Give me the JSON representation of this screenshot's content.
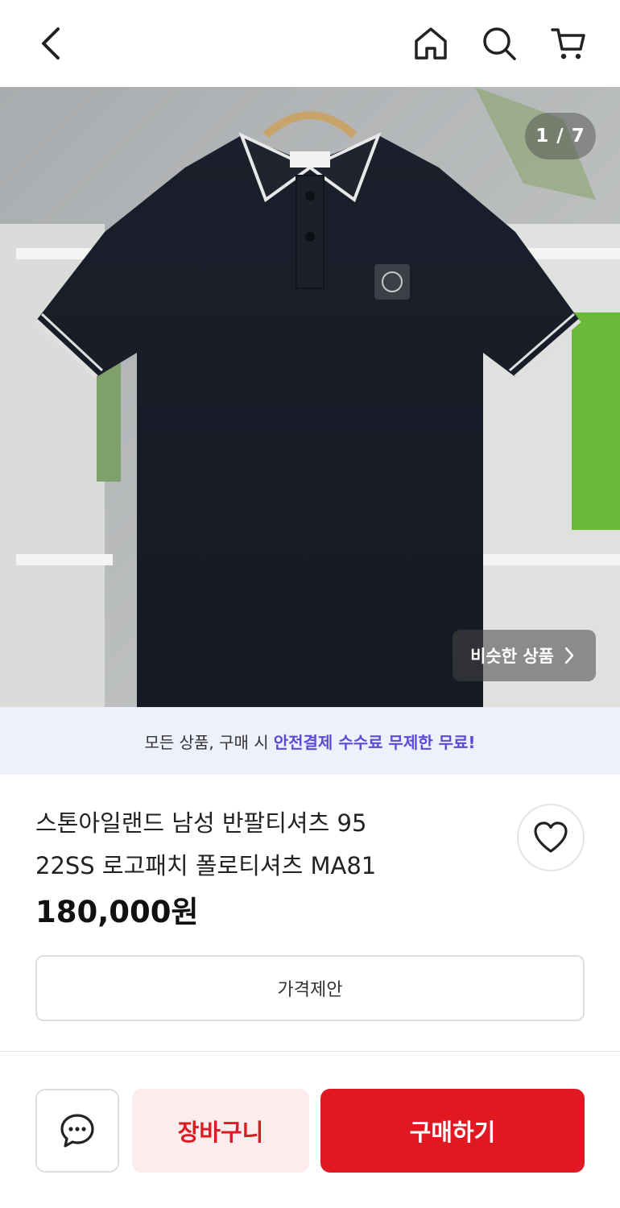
{
  "header": {
    "back_icon": "chevron-left-icon",
    "home_icon": "home-icon",
    "search_icon": "search-icon",
    "cart_icon": "cart-icon"
  },
  "gallery": {
    "counter": "1 / 7",
    "similar_label": "비슷한 상품"
  },
  "banner": {
    "text": "모든 상품, 구매 시",
    "highlight": "안전결제 수수료 무제한 무료!",
    "highlight_color": "#5a4bd6"
  },
  "product": {
    "title_line1": "스톤아일랜드 남성 반팔티셔츠 95",
    "title_line2": "22SS 로고패치 폴로티셔츠 MA81",
    "price": "180,000원"
  },
  "actions": {
    "offer_label": "가격제안",
    "basket_label": "장바구니",
    "buy_label": "구매하기",
    "brand_color": "#e01822"
  }
}
